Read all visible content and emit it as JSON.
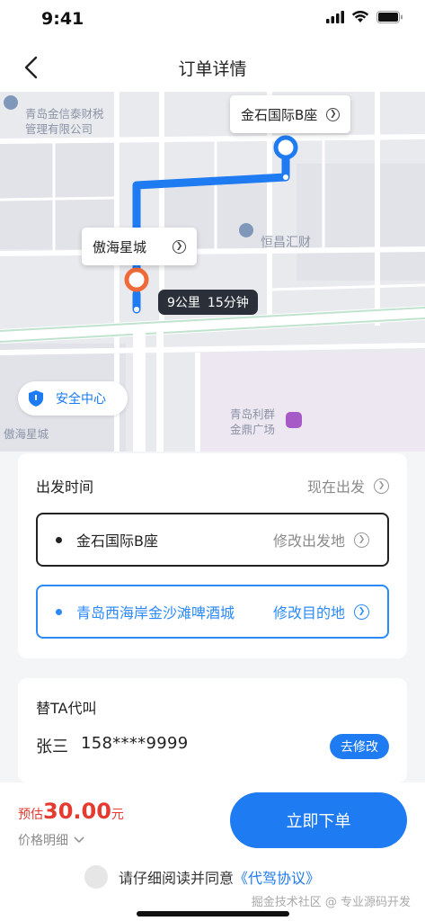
{
  "status_bar": {
    "time": "9:41"
  },
  "nav": {
    "title": "订单详情"
  },
  "map": {
    "poi_top_left": [
      "青岛金信泰财税",
      "管理有限公司"
    ],
    "poi_middle": "恒昌汇财",
    "poi_bottom_right": [
      "青岛利群",
      "金鼎广场"
    ],
    "poi_bottom_left": "傲海星城",
    "start_callout": "金石国际B座",
    "end_callout": "傲海星城",
    "distance": "9公里",
    "duration": "15分钟",
    "safety_label": "安全中心",
    "route_color": "#1f7bf2",
    "end_marker_color": "#ef6a3a"
  },
  "order": {
    "depart_label": "出发时间",
    "depart_value": "现在出发",
    "from_address": "金石国际B座",
    "from_action": "修改出发地",
    "to_address": "青岛西海岸金沙滩啤酒城",
    "to_action": "修改目的地"
  },
  "proxy": {
    "title": "替TA代叫",
    "name": "张三",
    "phone": "158****9999",
    "edit_label": "去修改"
  },
  "footer": {
    "price_prefix": "预估",
    "price_value": "30.00",
    "price_unit": "元",
    "price_detail": "价格明细",
    "order_button": "立即下单",
    "agree_text": "请仔细阅读并同意",
    "agree_link": "《代驾协议》",
    "watermark": "掘金技术社区 @ 专业源码开发"
  },
  "colors": {
    "accent": "#1f7bf2",
    "price": "#e53a2f"
  }
}
